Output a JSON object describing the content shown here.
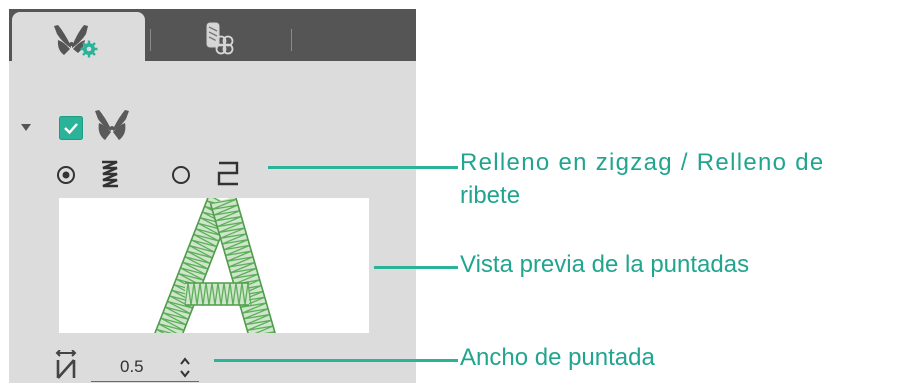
{
  "tabs": [
    {
      "icon": "butterfly-gear-icon",
      "active": true
    },
    {
      "icon": "thread-spools-icon",
      "active": false
    }
  ],
  "stitch_width": {
    "value": "0.5"
  },
  "preview": {
    "letter": "A",
    "stitch_color": "#5fae5b"
  },
  "callouts": {
    "fill_type_line1": "Relleno en zigzag / Relleno de",
    "fill_type_line2": "ribete",
    "preview": "Vista previa de la puntadas",
    "width": "Ancho de puntada"
  },
  "colors": {
    "accent": "#22a58f",
    "checkbox": "#2bb39a"
  }
}
